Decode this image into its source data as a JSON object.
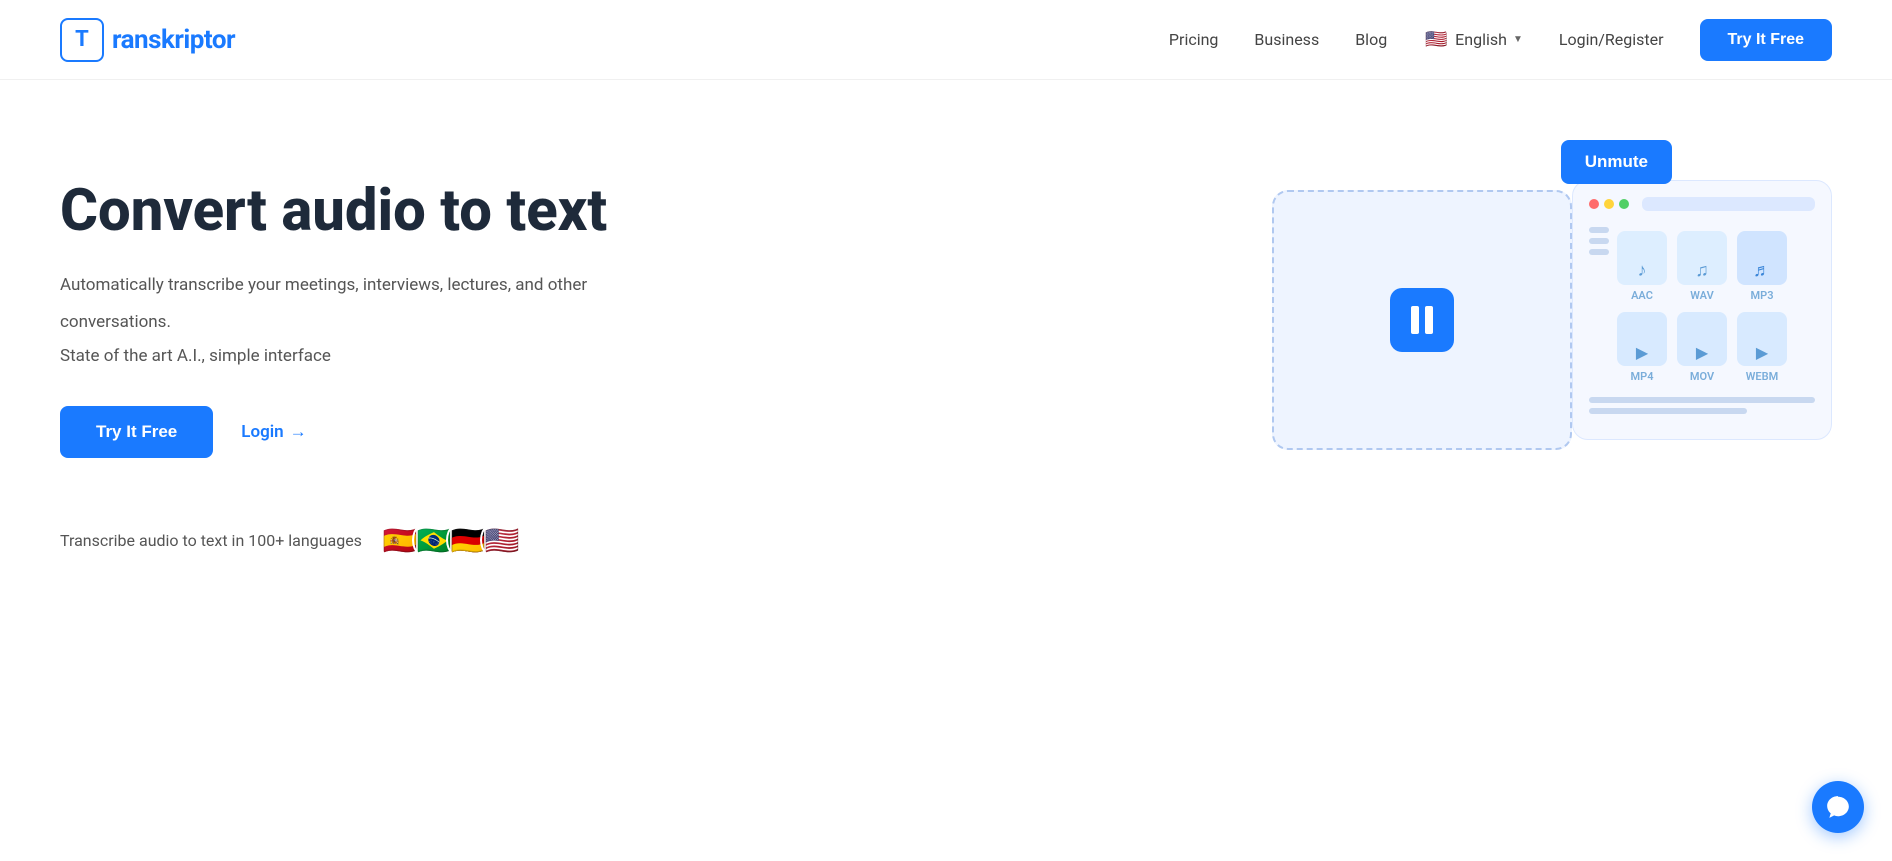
{
  "navbar": {
    "logo_letter": "T",
    "logo_name": "ranskriptor",
    "nav_items": [
      {
        "label": "Pricing",
        "id": "pricing"
      },
      {
        "label": "Business",
        "id": "business"
      },
      {
        "label": "Blog",
        "id": "blog"
      }
    ],
    "language": {
      "flag": "🇺🇸",
      "label": "English"
    },
    "login_label": "Login/Register",
    "cta_label": "Try It Free"
  },
  "hero": {
    "title": "Convert audio to text",
    "subtitle1": "Automatically transcribe your meetings, interviews, lectures, and other",
    "subtitle2": "conversations.",
    "subtitle3": "State of the art A.I., simple interface",
    "cta_label": "Try It Free",
    "login_label": "Login",
    "login_arrow": "→",
    "languages_text": "Transcribe audio to text in 100+ languages",
    "flags": [
      "🇪🇸",
      "🇧🇷",
      "🇩🇪",
      "🇺🇸"
    ],
    "unmute_label": "Unmute"
  },
  "formats": {
    "items": [
      {
        "label": "AAC",
        "type": "audio"
      },
      {
        "label": "WAV",
        "type": "audio"
      },
      {
        "label": "MP3",
        "type": "audio"
      },
      {
        "label": "MP4",
        "type": "video"
      },
      {
        "label": "MOV",
        "type": "video"
      },
      {
        "label": "WEBM",
        "type": "video"
      }
    ]
  },
  "chat": {
    "icon": "chat-icon"
  },
  "colors": {
    "primary": "#1a7aff",
    "text_dark": "#1e2a3a",
    "text_muted": "#555"
  }
}
